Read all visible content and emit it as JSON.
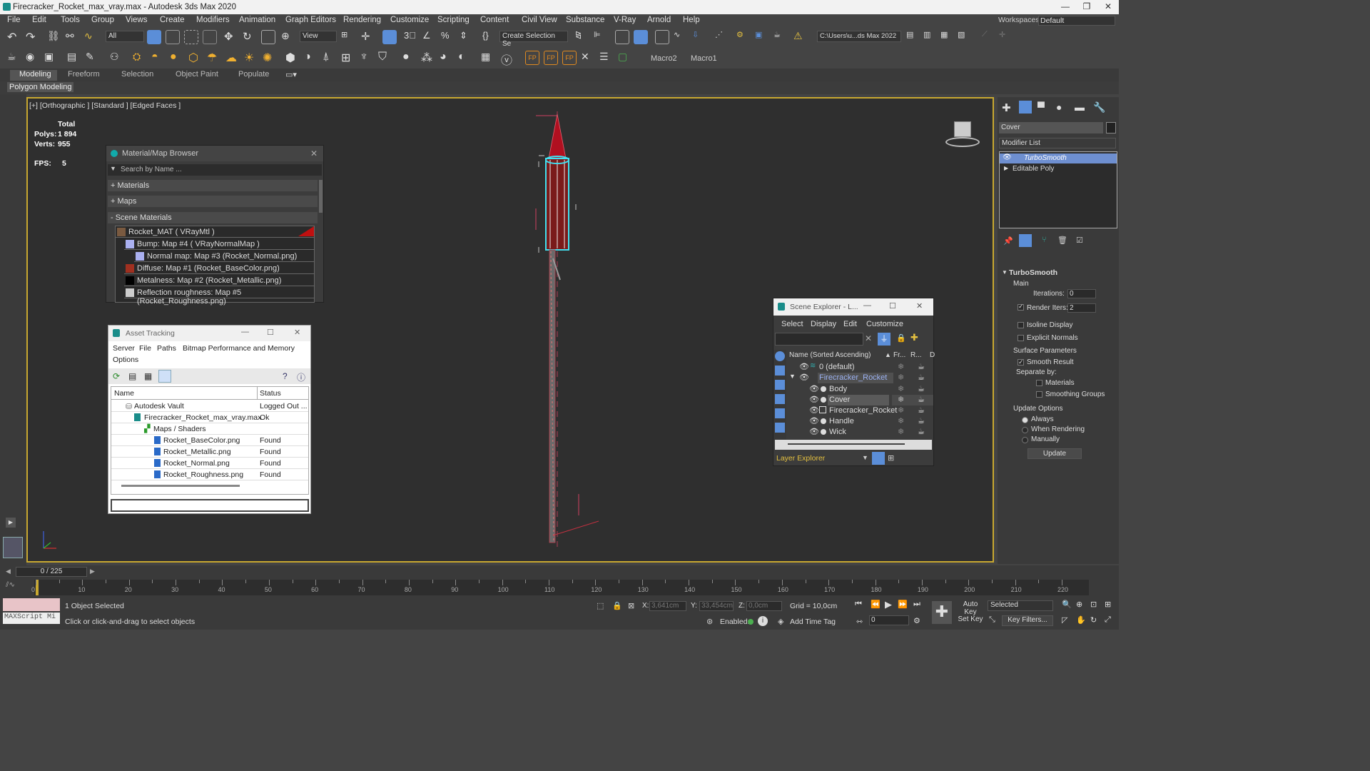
{
  "window": {
    "title": "Firecracker_Rocket_max_vray.max - Autodesk 3ds Max 2020"
  },
  "menu": [
    "File",
    "Edit",
    "Tools",
    "Group",
    "Views",
    "Create",
    "Modifiers",
    "Animation",
    "Graph Editors",
    "Rendering",
    "Customize",
    "Scripting",
    "Content",
    "Civil View",
    "Substance",
    "V-Ray",
    "Arnold",
    "Help"
  ],
  "workspaces": {
    "label": "Workspaces:",
    "value": "Default"
  },
  "toolbar": {
    "filter": "All",
    "view": "View",
    "selection_set": "Create Selection Se",
    "path": "C:\\Users\\u...ds Max 2022"
  },
  "macros": {
    "macro2": "Macro2",
    "macro1": "Macro1"
  },
  "ribbon": {
    "tabs": [
      "Modeling",
      "Freeform",
      "Selection",
      "Object Paint",
      "Populate"
    ],
    "sub": "Polygon Modeling"
  },
  "viewport": {
    "label": "[+] [Orthographic ] [Standard ] [Edged Faces ]",
    "stats_total": "Total",
    "polys_label": "Polys:",
    "polys": "1 894",
    "verts_label": "Verts:",
    "verts": "955",
    "fps_label": "FPS:",
    "fps": "5"
  },
  "material_browser": {
    "title": "Material/Map Browser",
    "search": "Search by Name ...",
    "groups": [
      "+ Materials",
      "+ Maps",
      "- Scene Materials"
    ],
    "items": [
      "Rocket_MAT  ( VRayMtl )",
      "Bump: Map #4  ( VRayNormalMap )",
      "Normal map: Map #3 (Rocket_Normal.png)",
      "Diffuse: Map #1 (Rocket_BaseColor.png)",
      "Metalness: Map #2 (Rocket_Metallic.png)",
      "Reflection roughness: Map #5 (Rocket_Roughness.png)"
    ]
  },
  "asset_tracking": {
    "title": "Asset Tracking",
    "menu": [
      "Server",
      "File",
      "Paths",
      "Bitmap Performance and Memory"
    ],
    "menu2": "Options",
    "cols": [
      "Name",
      "Status"
    ],
    "rows": [
      [
        "Autodesk Vault",
        "Logged Out ..."
      ],
      [
        "Firecracker_Rocket_max_vray.max",
        "Ok"
      ],
      [
        "Maps / Shaders",
        ""
      ],
      [
        "Rocket_BaseColor.png",
        "Found"
      ],
      [
        "Rocket_Metallic.png",
        "Found"
      ],
      [
        "Rocket_Normal.png",
        "Found"
      ],
      [
        "Rocket_Roughness.png",
        "Found"
      ]
    ]
  },
  "scene_explorer": {
    "title": "Scene Explorer - L...",
    "menu": [
      "Select",
      "Display",
      "Edit",
      "Customize"
    ],
    "cols": [
      "Name (Sorted Ascending)",
      "Fr...",
      "R...",
      "D"
    ],
    "rows": [
      "0 (default)",
      "Firecracker_Rocket",
      "Body",
      "Cover",
      "Firecracker_Rocket",
      "Handle",
      "Wick"
    ],
    "footer": "Layer Explorer"
  },
  "command_panel": {
    "object_name": "Cover",
    "modifier_list": "Modifier List",
    "stack": [
      "TurboSmooth",
      "Editable Poly"
    ],
    "rollout": "TurboSmooth",
    "main": "Main",
    "iterations_label": "Iterations:",
    "iterations": "0",
    "render_iters_label": "Render Iters:",
    "render_iters": "2",
    "isoline": "Isoline Display",
    "explicit": "Explicit Normals",
    "surface": "Surface Parameters",
    "smooth_result": "Smooth Result",
    "separate": "Separate by:",
    "materials": "Materials",
    "smoothing_groups": "Smoothing Groups",
    "update_options": "Update Options",
    "always": "Always",
    "when_rendering": "When Rendering",
    "manually": "Manually",
    "update": "Update"
  },
  "timeline": {
    "frame": "0 / 225",
    "ticks": [
      "0",
      "10",
      "20",
      "30",
      "40",
      "50",
      "60",
      "70",
      "80",
      "90",
      "100",
      "110",
      "120",
      "130",
      "140",
      "150",
      "160",
      "170",
      "180",
      "190",
      "200",
      "210",
      "220"
    ]
  },
  "status": {
    "script": "MAXScript Mi",
    "selected": "1 Object Selected",
    "hint": "Click or click-and-drag to select objects",
    "x_label": "X:",
    "x": "3,641cm",
    "y_label": "Y:",
    "y": "33,454cm",
    "z_label": "Z:",
    "z": "0,0cm",
    "grid": "Grid = 10,0cm",
    "enabled": "Enabled:",
    "add_time_tag": "Add Time Tag",
    "auto_key": "Auto Key",
    "selected_dd": "Selected",
    "set_key": "Set Key",
    "key_filters": "Key Filters...",
    "frame_field": "0"
  }
}
